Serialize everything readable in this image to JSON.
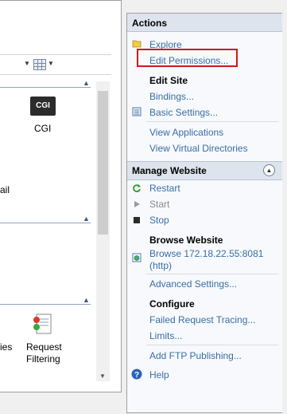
{
  "left_pane": {
    "features": [
      {
        "label": "CGI",
        "icon": "cgi-icon",
        "icon_text": "CGI"
      },
      {
        "label": "ail"
      },
      {
        "label": "ies"
      },
      {
        "label": "Request Filtering",
        "icon": "request-filtering-icon"
      }
    ]
  },
  "actions": {
    "title": "Actions",
    "explore": "Explore",
    "edit_permissions": "Edit Permissions...",
    "edit_site_title": "Edit Site",
    "bindings": "Bindings...",
    "basic_settings": "Basic Settings...",
    "view_applications": "View Applications",
    "view_virtual_directories": "View Virtual Directories",
    "manage_website_title": "Manage Website",
    "restart": "Restart",
    "start": "Start",
    "stop": "Stop",
    "browse_website_title": "Browse Website",
    "browse_line1": "Browse 172.18.22.55:8081",
    "browse_line2": "(http)",
    "advanced_settings": "Advanced Settings...",
    "configure_title": "Configure",
    "failed_request_tracing": "Failed Request Tracing...",
    "limits": "Limits...",
    "add_ftp_publishing": "Add FTP Publishing...",
    "help": "Help"
  },
  "highlight_color": "#d0181a",
  "link_color": "#3a6ea5"
}
